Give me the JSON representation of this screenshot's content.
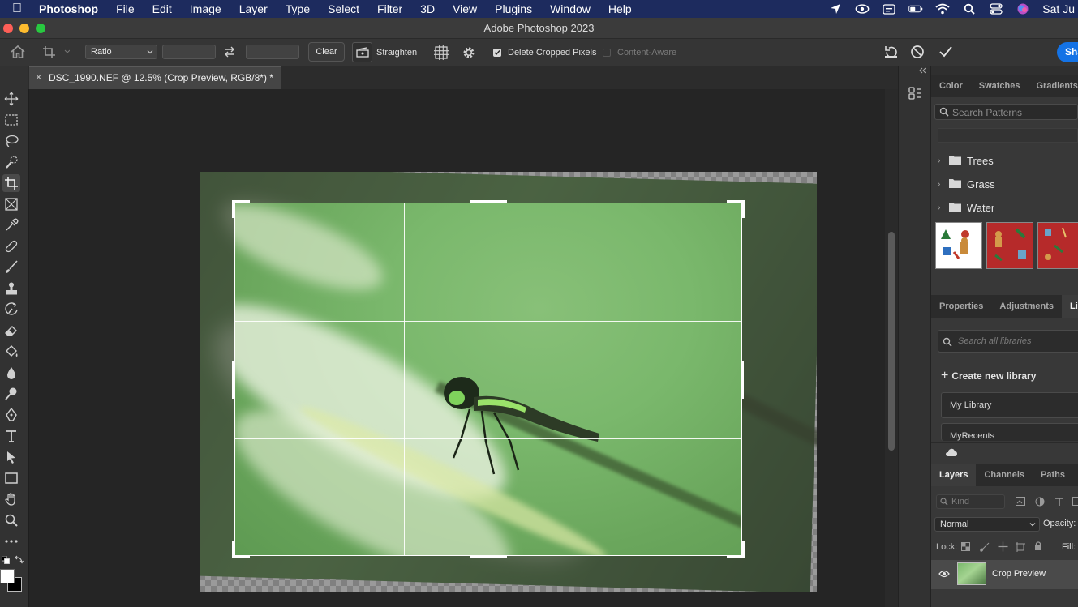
{
  "menubar": {
    "app": "Photoshop",
    "items": [
      "File",
      "Edit",
      "Image",
      "Layer",
      "Type",
      "Select",
      "Filter",
      "3D",
      "View",
      "Plugins",
      "Window",
      "Help"
    ],
    "clock": "Sat Ju"
  },
  "window": {
    "title": "Adobe Photoshop 2023"
  },
  "options": {
    "ratio_value": "Ratio",
    "clear_label": "Clear",
    "straighten_label": "Straighten",
    "delete_cropped_label": "Delete Cropped Pixels",
    "delete_cropped_checked": true,
    "content_aware_label": "Content-Aware",
    "content_aware_checked": false,
    "share_label": "Sha"
  },
  "document": {
    "tab_title": "DSC_1990.NEF @ 12.5% (Crop Preview, RGB/8*) *"
  },
  "panel_top": {
    "tabs": [
      "Color",
      "Swatches",
      "Gradients"
    ],
    "search_placeholder": "Search Patterns",
    "folders": [
      "Trees",
      "Grass",
      "Water"
    ]
  },
  "panel_mid": {
    "tabs": [
      "Properties",
      "Adjustments",
      "Libr"
    ],
    "search_placeholder": "Search all libraries",
    "create_label": "Create new library",
    "libraries": [
      "My Library",
      "MyRecents"
    ]
  },
  "panel_layers": {
    "tabs": [
      "Layers",
      "Channels",
      "Paths"
    ],
    "kind_placeholder": "Kind",
    "blend_mode": "Normal",
    "opacity_label": "Opacity:",
    "lock_label": "Lock:",
    "fill_label": "Fill:",
    "layer_name": "Crop Preview"
  },
  "colors": {
    "accent": "#1473e6",
    "menubar": "#1d2b5e",
    "panel": "#2f2f2f"
  }
}
